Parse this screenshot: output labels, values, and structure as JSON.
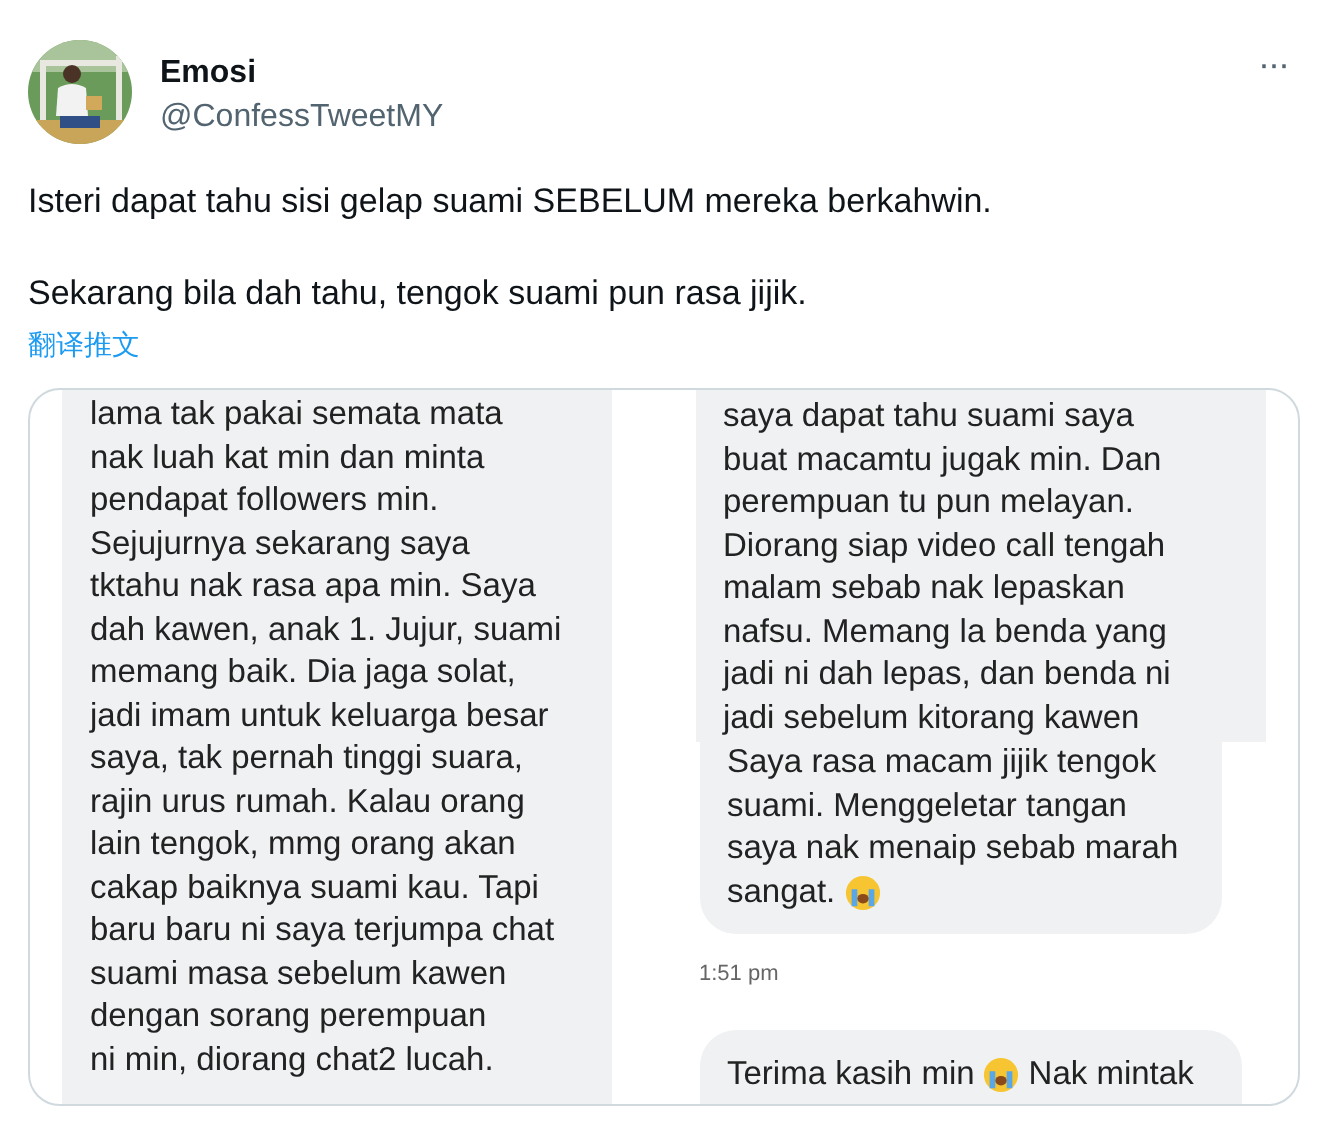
{
  "tweet": {
    "author": {
      "name": "Emosi",
      "handle": "@ConfessTweetMY"
    },
    "more": "···",
    "paragraphs": [
      "Isteri dapat tahu sisi gelap suami SEBELUM mereka berkahwin.",
      "Sekarang bila dah tahu, tengok suami pun rasa jijik."
    ],
    "translate_link": "翻译推文",
    "media": [
      {
        "kind": "plain",
        "lines": [
          "lama tak pakai semata mata",
          "nak luah kat min dan minta",
          "pendapat followers min.",
          "Sejujurnya sekarang saya",
          "tktahu nak rasa apa min. Saya",
          "dah kawen, anak 1. Jujur, suami",
          "memang baik. Dia jaga solat,",
          "jadi imam untuk keluarga besar",
          "saya, tak pernah tinggi suara,",
          "rajin urus rumah. Kalau orang",
          "lain tengok, mmg orang akan",
          "cakap baiknya suami kau. Tapi",
          "baru baru ni saya terjumpa chat",
          "suami masa sebelum kawen",
          "dengan sorang perempuan",
          "ni min, diorang chat2 lucah."
        ]
      },
      {
        "kind": "chat",
        "block": [
          "saya dapat tahu suami saya",
          "buat macamtu jugak min. Dan",
          "perempuan tu pun melayan.",
          "Diorang siap video call tengah",
          "malam sebab nak lepaskan",
          "nafsu. Memang la benda yang",
          "jadi ni dah lepas, dan benda ni",
          "jadi sebelum kitorang kawen"
        ],
        "bubbles": [
          {
            "lines": [
              [
                "Saya rasa macam jijik tengok"
              ],
              [
                "suami. Menggeletar tangan"
              ],
              [
                "saya nak menaip sebab marah"
              ],
              [
                "sangat.",
                {
                  "kind": "emoji"
                }
              ]
            ],
            "time": "1:51 pm"
          },
          {
            "lines": [
              [
                "Terima kasih min",
                {
                  "kind": "emoji"
                },
                "Nak mintak"
              ]
            ]
          }
        ]
      }
    ]
  }
}
